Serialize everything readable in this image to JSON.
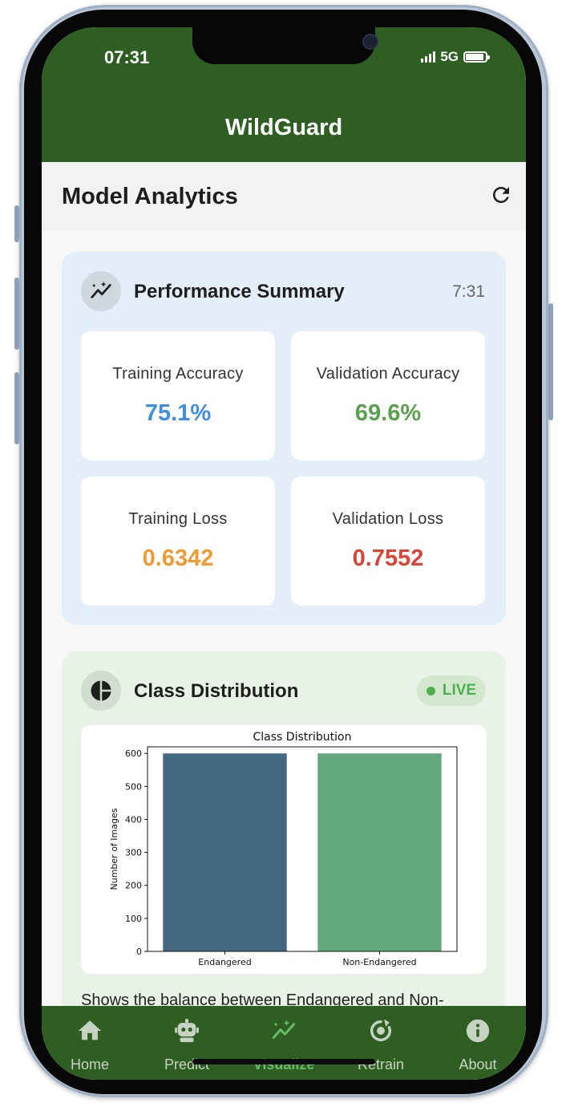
{
  "status_bar": {
    "time": "07:31",
    "network": "5G"
  },
  "app_bar": {
    "title": "WildGuard"
  },
  "page_header": {
    "title": "Model Analytics",
    "refresh_icon": "refresh-icon"
  },
  "performance": {
    "title": "Performance Summary",
    "time": "7:31",
    "icon": "auto-graph-icon",
    "metrics": [
      {
        "label": "Training Accuracy",
        "value": "75.1%",
        "color": "#3f8ee0"
      },
      {
        "label": "Validation Accuracy",
        "value": "69.6%",
        "color": "#5aa14f"
      },
      {
        "label": "Training Loss",
        "value": "0.6342",
        "color": "#f09a30"
      },
      {
        "label": "Validation Loss",
        "value": "0.7552",
        "color": "#dc4437"
      }
    ]
  },
  "class_distribution": {
    "title": "Class Distribution",
    "icon": "pie-chart-icon",
    "badge": "LIVE",
    "description": "Shows the balance between Endangered and Non-"
  },
  "chart_data": {
    "type": "bar",
    "title": "Class Distribution",
    "xlabel": "",
    "ylabel": "Number of Images",
    "categories": [
      "Endangered",
      "Non-Endangered"
    ],
    "values": [
      600,
      600
    ],
    "colors": [
      "#456882",
      "#62a87c"
    ],
    "ylim": [
      0,
      620
    ],
    "yticks": [
      0,
      100,
      200,
      300,
      400,
      500,
      600
    ],
    "grid": false
  },
  "bottom_nav": {
    "items": [
      {
        "label": "Home",
        "icon": "home-icon",
        "active": false
      },
      {
        "label": "Predict",
        "icon": "robot-icon",
        "active": false
      },
      {
        "label": "Visualize",
        "icon": "auto-graph-icon",
        "active": true
      },
      {
        "label": "Retrain",
        "icon": "retrain-icon",
        "active": false
      },
      {
        "label": "About",
        "icon": "info-icon",
        "active": false
      }
    ]
  }
}
